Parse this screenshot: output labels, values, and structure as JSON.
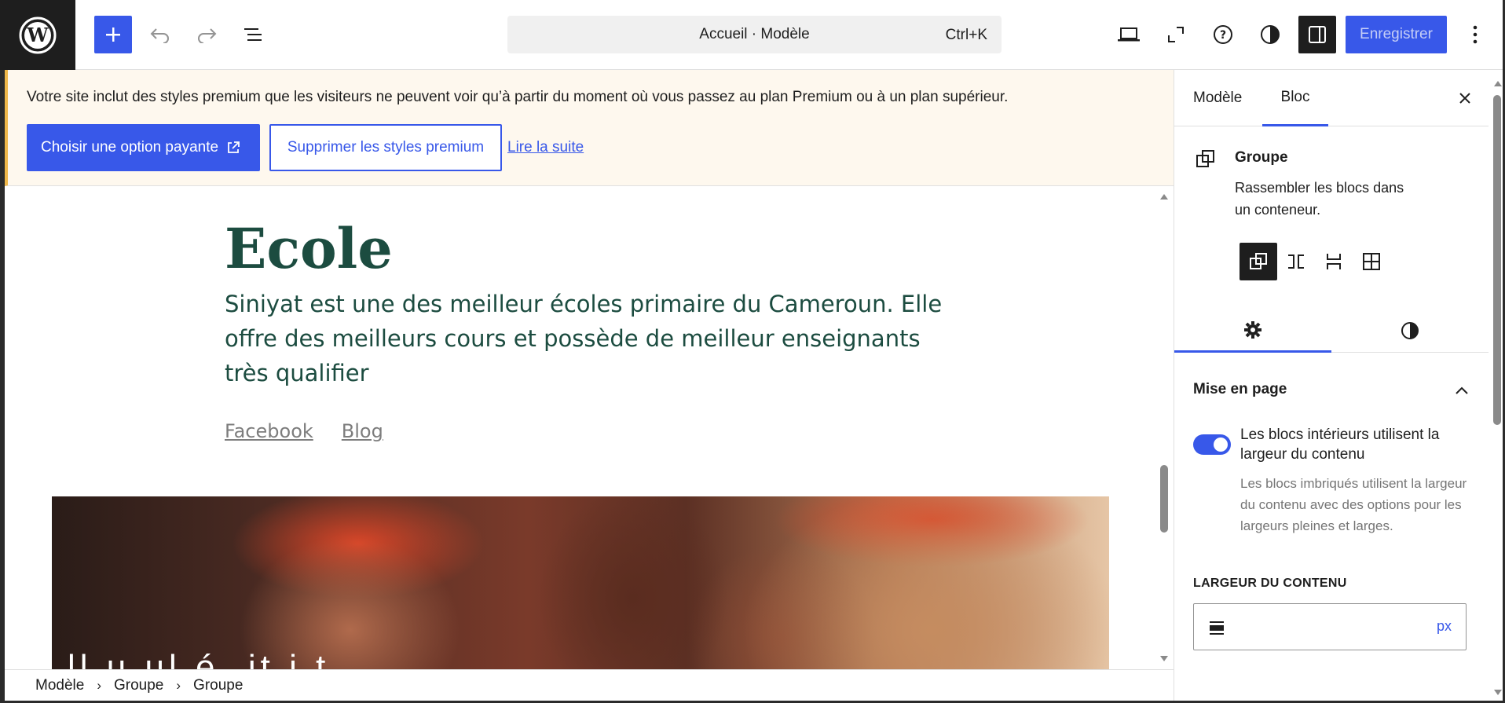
{
  "toolbar": {
    "logo_icon": "wordpress-logo-icon",
    "add_icon": "plus-icon",
    "undo_icon": "undo-icon",
    "redo_icon": "redo-icon",
    "list_view_icon": "list-view-icon",
    "command_title": "Accueil · Modèle",
    "command_shortcut": "Ctrl+K",
    "save_label": "Enregistrer",
    "accent_color": "#3858e9"
  },
  "notice": {
    "text": "Votre site inclut des styles premium que les visiteurs ne peuvent voir qu’à partir du moment où vous passez au plan Premium ou à un plan supérieur.",
    "primary_label": "Choisir une option payante",
    "secondary_label": "Supprimer les styles premium",
    "link_label": "Lire la suite",
    "border_color": "#f0b849"
  },
  "canvas": {
    "site_title": "Ecole",
    "site_description": "Siniyat est une des meilleur écoles primaire du Cameroun. Elle offre des meilleurs cours et possède de meilleur enseignants très qualifier",
    "nav": [
      {
        "label": "Facebook"
      },
      {
        "label": "Blog"
      }
    ],
    "cover_partial_text": "ll  u  ul é   ,it      i        t",
    "title_color": "#1c4c40"
  },
  "breadcrumb": {
    "items": [
      "Modèle",
      "Groupe",
      "Groupe"
    ]
  },
  "sidebar": {
    "tabs": [
      {
        "label": "Modèle"
      },
      {
        "label": "Bloc"
      }
    ],
    "active_tab": "Bloc",
    "block": {
      "title": "Groupe",
      "description": "Rassembler les blocs dans un conteneur."
    },
    "variations": [
      "group-icon",
      "row-icon",
      "stack-icon",
      "grid-icon"
    ],
    "subtabs": [
      "settings-gear-icon",
      "styles-half-circle-icon"
    ],
    "panel": {
      "title": "Mise en page",
      "toggle_label": "Les blocs intérieurs utilisent la largeur du contenu",
      "toggle_on": true,
      "toggle_help": "Les blocs imbriqués utilisent la largeur du contenu avec des options pour les largeurs pleines et larges.",
      "width_label": "LARGEUR DU CONTENU",
      "width_value": "",
      "width_unit": "px"
    }
  }
}
